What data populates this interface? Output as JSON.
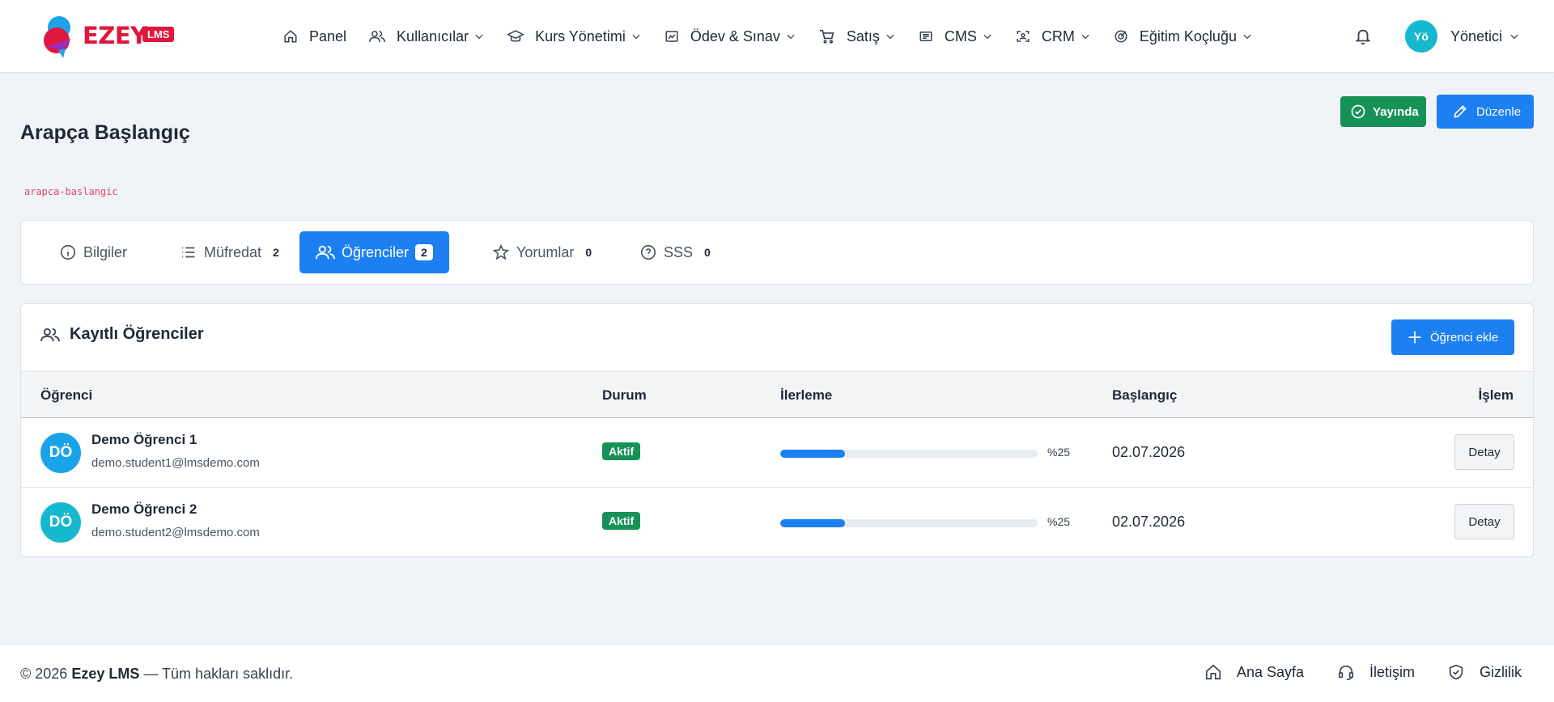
{
  "brand": {
    "name": "EZEY",
    "badge": "LMS",
    "accent": "#e0173f"
  },
  "nav": {
    "items": [
      {
        "label": "Panel",
        "icon": "home-icon"
      },
      {
        "label": "Kullanıcılar",
        "icon": "users-icon"
      },
      {
        "label": "Kurs Yönetimi",
        "icon": "graduation-cap-icon"
      },
      {
        "label": "Ödev & Sınav",
        "icon": "image-chart-icon"
      },
      {
        "label": "Satış",
        "icon": "cart-icon"
      },
      {
        "label": "CMS",
        "icon": "news-icon"
      },
      {
        "label": "CRM",
        "icon": "scan-face-icon"
      },
      {
        "label": "Eğitim Koçluğu",
        "icon": "target-icon"
      }
    ],
    "user_initials": "Yö",
    "user_name": "Yönetici"
  },
  "course": {
    "title": "Arapça Başlangıç",
    "slug": "arapca-baslangic",
    "status_label": "Yayında",
    "edit_label": "Düzenle"
  },
  "tabs": [
    {
      "label": "Bilgiler",
      "count": "",
      "icon": "info-icon"
    },
    {
      "label": "Müfredat",
      "count": "2",
      "icon": "list-icon"
    },
    {
      "label": "Öğrenciler",
      "count": "2",
      "icon": "users-icon"
    },
    {
      "label": "Yorumlar",
      "count": "0",
      "icon": "star-icon"
    },
    {
      "label": "SSS",
      "count": "0",
      "icon": "question-icon"
    }
  ],
  "students": {
    "title": "Kayıtlı Öğrenciler",
    "add_label": "Öğrenci ekle",
    "columns": {
      "student": "Öğrenci",
      "status": "Durum",
      "progress": "İlerleme",
      "start": "Başlangıç",
      "action": "İşlem"
    },
    "rows": [
      {
        "initials": "DÖ",
        "avatar_color": "#1aa3e8",
        "name": "Demo Öğrenci 1",
        "email": "demo.student1@lmsdemo.com",
        "status": "Aktif",
        "progress_label": "%25",
        "progress": 0.25,
        "start": "02.07.2026",
        "action": "Detay"
      },
      {
        "initials": "DÖ",
        "avatar_color": "#16b8cf",
        "name": "Demo Öğrenci 2",
        "email": "demo.student2@lmsdemo.com",
        "status": "Aktif",
        "progress_label": "%25",
        "progress": 0.25,
        "start": "02.07.2026",
        "action": "Detay"
      }
    ]
  },
  "footer": {
    "copyright_prefix": "© 2026",
    "brand": "Ezey LMS",
    "copyright_suffix": "— Tüm hakları saklıdır.",
    "links": [
      {
        "label": "Ana Sayfa",
        "icon": "home-icon"
      },
      {
        "label": "İletişim",
        "icon": "headset-icon"
      },
      {
        "label": "Gizlilik",
        "icon": "shield-icon"
      }
    ]
  },
  "colors": {
    "primary": "#1c7ff2",
    "success": "#179257",
    "brand": "#e0173f"
  }
}
